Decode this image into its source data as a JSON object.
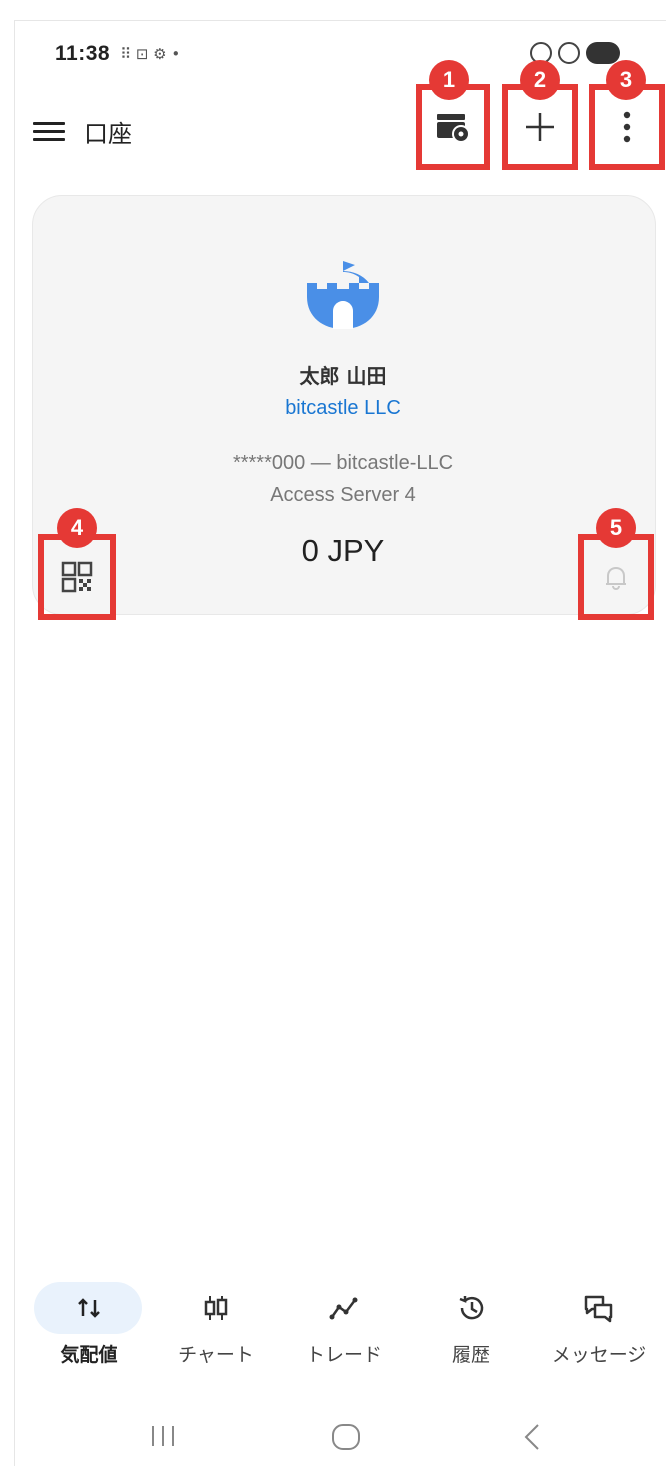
{
  "status_bar": {
    "time": "11:38",
    "icons_left": "⠿ ⊡ ⚙ •"
  },
  "header": {
    "title": "口座"
  },
  "toolbar_badges": [
    "1",
    "2",
    "3"
  ],
  "card_badges": [
    "4",
    "5"
  ],
  "account": {
    "holder_name": "太郎 山田",
    "broker": "bitcastle LLC",
    "account_line": "*****000 — bitcastle-LLC",
    "server": "Access Server 4",
    "balance": "0 JPY"
  },
  "bottom_nav": [
    {
      "label": "気配値",
      "icon": "quotes-icon",
      "active": true
    },
    {
      "label": "チャート",
      "icon": "chart-icon",
      "active": false
    },
    {
      "label": "トレード",
      "icon": "trade-icon",
      "active": false
    },
    {
      "label": "履歴",
      "icon": "history-icon",
      "active": false
    },
    {
      "label": "メッセージ",
      "icon": "messages-icon",
      "active": false
    }
  ],
  "colors": {
    "accent": "#1976d2",
    "annotation": "#e53935",
    "logo": "#4a8fe7"
  }
}
